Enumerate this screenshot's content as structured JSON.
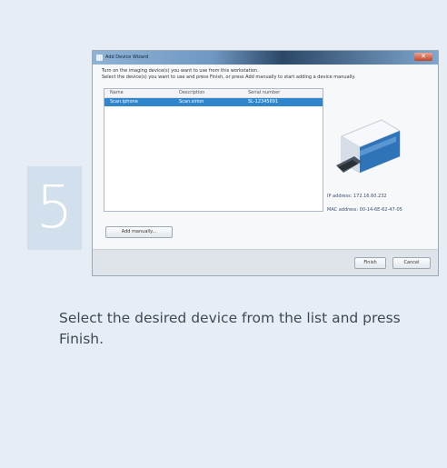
{
  "step": {
    "number": "5"
  },
  "dialog": {
    "title": "Add Device Wizard",
    "close_label": "✕",
    "instruction_line1": "Turn on the imaging device(s) you want to use from this workstation.",
    "instruction_line2": "Select the device(s) you want to use and press Finish, or press Add manually to start adding a device manually.",
    "columns": [
      "Name",
      "Description",
      "Serial number"
    ],
    "rows": [
      {
        "name": "Scan.iphone",
        "description": "Scan.sirion",
        "serial": "SL-12345691"
      }
    ],
    "ip_label": "IP address:   172.16.60.232",
    "mac_label": "MAC address:  00-14-6E-62-47-05",
    "add_manually_label": "Add manually...",
    "finish_label": "Finish",
    "cancel_label": "Cancel"
  },
  "caption": "Select the desired device from the list and press Finish.",
  "colors": {
    "background": "#e6edf4",
    "step_box": "#d2dfec",
    "selection": "#2f86cc",
    "caption_text": "#3d4a57"
  }
}
